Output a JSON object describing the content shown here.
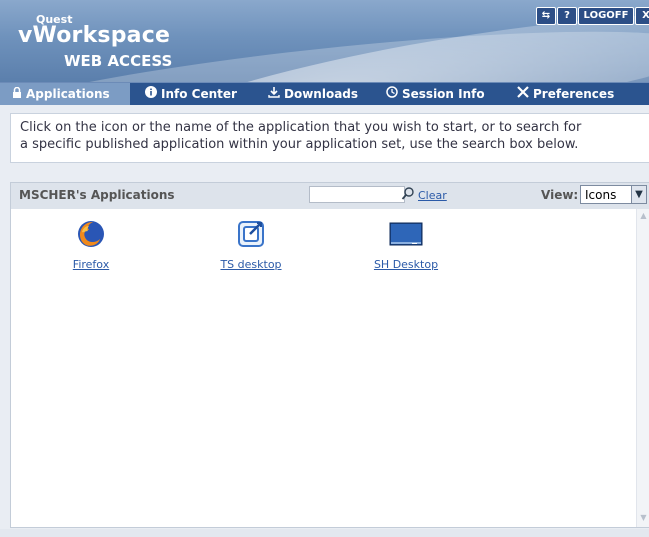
{
  "brand": {
    "line1": "Quest",
    "line2": "vWorkspace",
    "line3": "WEB ACCESS"
  },
  "header_buttons": {
    "refresh": "⇆",
    "help": "?",
    "logoff": "LOGOFF",
    "more": "X"
  },
  "nav": {
    "tabs": [
      {
        "label": "Applications",
        "icon": "lock-icon"
      },
      {
        "label": "Info Center",
        "icon": "info-icon"
      },
      {
        "label": "Downloads",
        "icon": "download-icon"
      },
      {
        "label": "Session Info",
        "icon": "clock-icon"
      },
      {
        "label": "Preferences",
        "icon": "tools-icon"
      }
    ]
  },
  "instructions": {
    "line1": "Click on the icon or the name of the application that you wish to start, or to search for",
    "line2": "a specific published application within your application set, use the search box below."
  },
  "apps_panel": {
    "title": "MSCHER's Applications",
    "search_value": "",
    "clear_label": "Clear",
    "view_label": "View:",
    "view_value": "Icons",
    "apps": [
      {
        "label": "Firefox",
        "icon": "firefox-icon"
      },
      {
        "label": "TS desktop",
        "icon": "ts-desktop-icon"
      },
      {
        "label": "SH Desktop",
        "icon": "monitor-icon"
      }
    ]
  }
}
